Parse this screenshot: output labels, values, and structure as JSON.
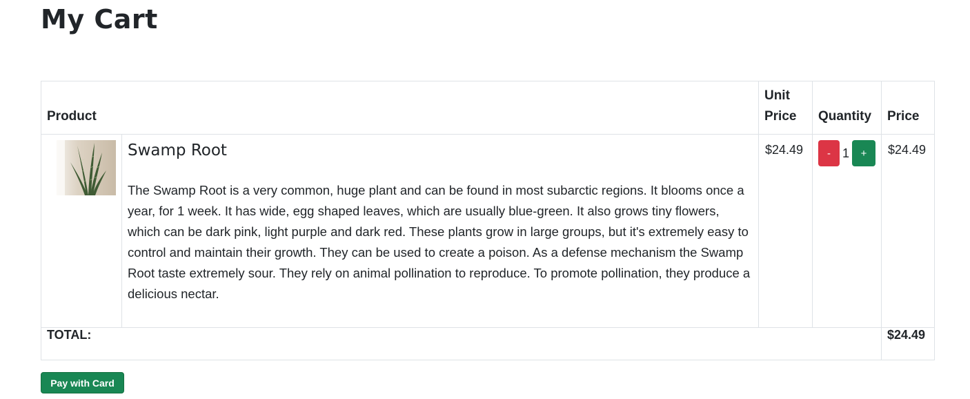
{
  "page": {
    "title": "My Cart"
  },
  "table": {
    "headers": {
      "product": "Product",
      "unit_price": "Unit Price",
      "quantity": "Quantity",
      "price": "Price"
    },
    "items": [
      {
        "name": "Swamp Root",
        "description": "The Swamp Root is a very common, huge plant and can be found in most subarctic regions. It blooms once a year, for 1 week. It has wide, egg shaped leaves, which are usually blue-green. It also grows tiny flowers, which can be dark pink, light purple and dark red. These plants grow in large groups, but it's extremely easy to control and maintain their growth. They can be used to create a poison. As a defense mechanism the Swamp Root taste extremely sour. They rely on animal pollination to reproduce. To promote pollination, they produce a delicious nectar.",
        "unit_price": "$24.49",
        "quantity": "1",
        "decrease_label": "-",
        "increase_label": "+",
        "price": "$24.49",
        "image_icon": "snake-plant-photo"
      }
    ],
    "total_label": "TOTAL:",
    "total_value": "$24.49"
  },
  "checkout": {
    "pay_label": "Pay with Card"
  },
  "colors": {
    "decrease": "#dc3545",
    "increase": "#198754",
    "pay": "#198754"
  }
}
